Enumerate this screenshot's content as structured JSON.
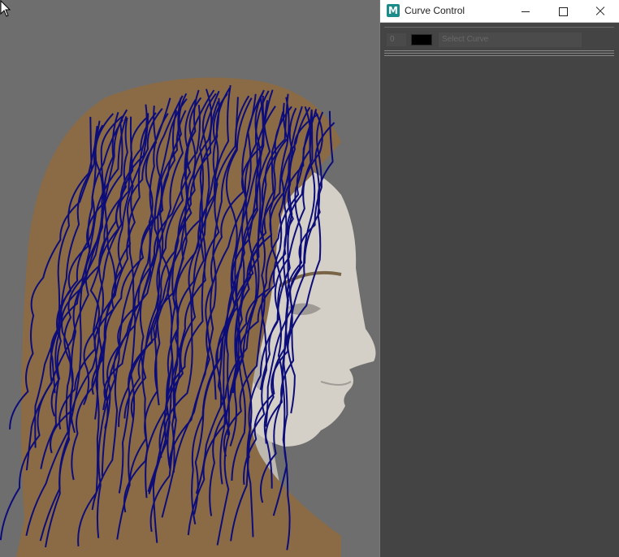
{
  "viewport": {
    "background_color": "#6e6e6e",
    "subject": "3d-head-with-hair-guide-curves",
    "curve_color": "#0d0d7a",
    "hair_color": "#8a6b45",
    "skin_color": "#d4d0c8"
  },
  "window": {
    "title": "Curve Control",
    "app_icon_letter": "M",
    "minimize_icon": "minimize-icon",
    "maximize_icon": "maximize-icon",
    "close_icon": "close-icon"
  },
  "curve_row": {
    "index": "0",
    "swatch_color": "#000000",
    "select_label": "Select Curve"
  }
}
